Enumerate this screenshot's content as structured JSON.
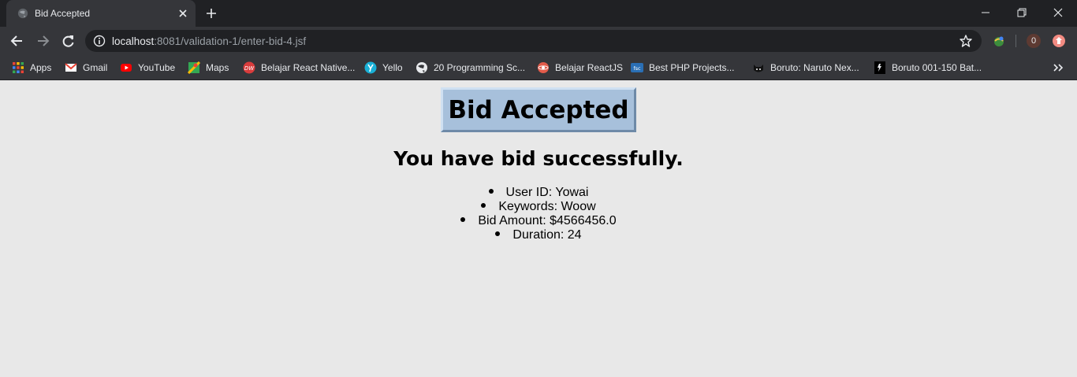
{
  "browser": {
    "tab": {
      "title": "Bid Accepted"
    },
    "address_bar": {
      "host": "localhost",
      "rest": ":8081/validation-1/enter-bid-4.jsf"
    },
    "extension_badge": "0",
    "bookmarks": [
      {
        "label": "Apps",
        "icon": "apps-grid-icon"
      },
      {
        "label": "Gmail",
        "icon": "gmail-icon"
      },
      {
        "label": "YouTube",
        "icon": "youtube-icon"
      },
      {
        "label": "Maps",
        "icon": "maps-icon"
      },
      {
        "label": "Belajar React Native...",
        "icon": "dw-icon"
      },
      {
        "label": "Yello",
        "icon": "yello-icon"
      },
      {
        "label": "20 Programming Sc...",
        "icon": "globe-icon"
      },
      {
        "label": "Belajar ReactJS",
        "icon": "react-logo-icon"
      },
      {
        "label": "Best PHP Projects...",
        "icon": "php-icon"
      },
      {
        "label": "Boruto: Naruto Nex...",
        "icon": "cat-icon"
      },
      {
        "label": "Boruto 001-150 Bat...",
        "icon": "boruto-icon"
      }
    ]
  },
  "page": {
    "heading": "Bid Accepted",
    "message": "You have bid successfully.",
    "details": [
      {
        "label": "User ID: Yowai"
      },
      {
        "label": "Keywords: Woow"
      },
      {
        "label": "Bid Amount: $4566456.0"
      },
      {
        "label": "Duration: 24"
      }
    ]
  },
  "colors": {
    "page_background": "#e8e8e8",
    "heading_box": "#a7c0db",
    "browser_frame": "#202124",
    "toolbar": "#35363a"
  }
}
